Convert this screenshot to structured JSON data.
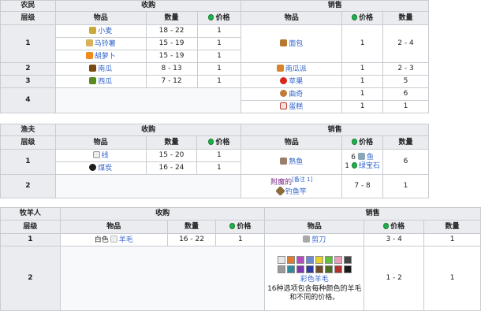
{
  "farmer": {
    "title": "农民",
    "buy_header": "收购",
    "sell_header": "销售",
    "col_level": "层级",
    "col_item": "物品",
    "col_qty": "数量",
    "col_price": "价格",
    "levels": [
      "1",
      "2",
      "3",
      "4"
    ],
    "buy": [
      {
        "item": "小麦",
        "qty": "18 - 22",
        "price": "1",
        "icon": "wheat-icon"
      },
      {
        "item": "马铃薯",
        "qty": "15 - 19",
        "price": "1",
        "icon": "potato-icon"
      },
      {
        "item": "胡萝卜",
        "qty": "15 - 19",
        "price": "1",
        "icon": "carrot-icon"
      },
      {
        "item": "南瓜",
        "qty": "8 - 13",
        "price": "1",
        "icon": "pumpkin-icon"
      },
      {
        "item": "西瓜",
        "qty": "7 - 12",
        "price": "1",
        "icon": "melon-icon"
      }
    ],
    "sell": [
      {
        "item": "面包",
        "price": "1",
        "qty": "2 - 4",
        "icon": "bread-icon"
      },
      {
        "item": "南瓜派",
        "price": "1",
        "qty": "2 - 3",
        "icon": "pumpkin-pie-icon"
      },
      {
        "item": "苹果",
        "price": "1",
        "qty": "5",
        "icon": "apple-icon"
      },
      {
        "item": "曲奇",
        "price": "1",
        "qty": "6",
        "icon": "cookie-icon"
      },
      {
        "item": "蛋糕",
        "price": "1",
        "qty": "1",
        "icon": "cake-icon"
      }
    ]
  },
  "fisherman": {
    "title": "渔夫",
    "buy_header": "收购",
    "sell_header": "销售",
    "col_level": "层级",
    "col_item": "物品",
    "col_qty": "数量",
    "col_price": "价格",
    "levels": [
      "1",
      "2"
    ],
    "buy": [
      {
        "item": "线",
        "qty": "15 - 20",
        "price": "1",
        "icon": "string-icon"
      },
      {
        "item": "煤炭",
        "qty": "16 - 24",
        "price": "1",
        "icon": "coal-icon"
      }
    ],
    "sell": [
      {
        "item": "熟鱼",
        "price_line1": "6",
        "price_item1": "鱼",
        "price_line2": "1",
        "price_item2": "绿宝石",
        "qty": "6",
        "icon": "cooked-fish-icon"
      },
      {
        "item_prefix": "附魔的",
        "note": "[备注 1]",
        "item": "钓鱼竿",
        "price": "7 - 8",
        "qty": "1",
        "icon": "fishing-rod-icon"
      }
    ]
  },
  "shepherd": {
    "title": "牧羊人",
    "buy_header": "收购",
    "sell_header": "销售",
    "col_level": "层级",
    "col_item": "物品",
    "col_qty": "数量",
    "col_price": "价格",
    "levels": [
      "1",
      "2"
    ],
    "buy": [
      {
        "item_prefix": "白色",
        "item": "羊毛",
        "qty": "16 - 22",
        "price": "1",
        "icon": "wool-icon"
      }
    ],
    "sell": [
      {
        "item": "剪刀",
        "price": "3 - 4",
        "qty": "1",
        "icon": "shears-icon"
      },
      {
        "item": "彩色羊毛",
        "desc": "16种选项包含每种颜色的羊毛和不同的价格。",
        "price": "1 - 2",
        "qty": "1",
        "icon": "colored-wool-icon"
      }
    ],
    "dye_colors": [
      "#e8e8e8",
      "#e07a2c",
      "#b24bbd",
      "#6a8ad6",
      "#e5d32c",
      "#5dc236",
      "#e8a0b8",
      "#444444",
      "#9a9a9a",
      "#2f8a9c",
      "#7b36b0",
      "#2e3d9c",
      "#6e4a2a",
      "#4e6b24",
      "#b3312c",
      "#1a1a1a"
    ]
  }
}
